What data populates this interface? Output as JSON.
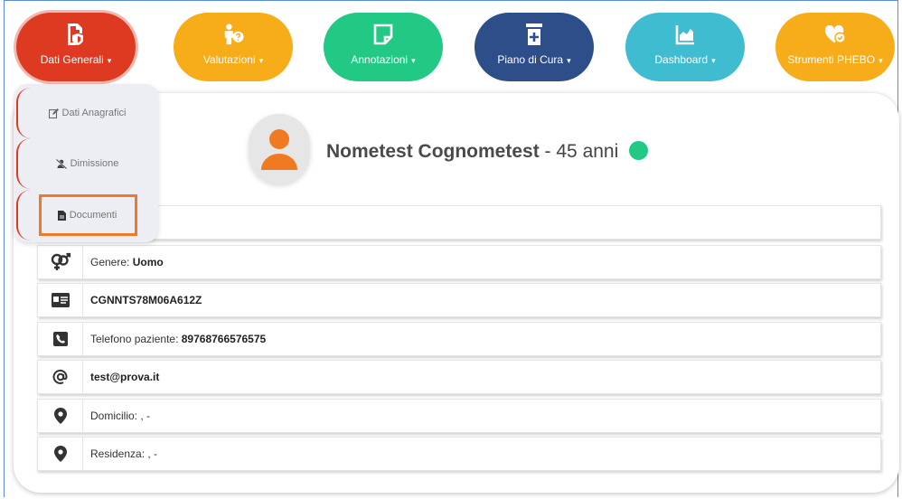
{
  "nav": {
    "dati_generali": "Dati Generali",
    "valutazioni": "Valutazioni",
    "annotazioni": "Annotazioni",
    "piano_di_cura": "Piano di Cura",
    "dashboard": "Dashboard",
    "strumenti_phebo": "Strumenti PHEBO",
    "caret": "▾"
  },
  "dropdown": {
    "dati_anagrafici": "Dati Anagrafici",
    "dimissione": "Dimissione",
    "documenti": "Documenti"
  },
  "patient": {
    "name": "Nometest Cognometest",
    "age": "- 45 anni"
  },
  "rows": {
    "genere_label": "Genere: ",
    "genere_value": "Uomo",
    "codice_fiscale": "CGNNTS78M06A612Z",
    "telefono_label": "Telefono paziente: ",
    "telefono_value": "89768766576575",
    "email": "test@prova.it",
    "domicilio": "Domicilio: , -",
    "residenza": "Residenza: , -"
  },
  "colors": {
    "red": "#dd3a21",
    "orange": "#f7ac19",
    "green": "#22c985",
    "navy": "#2e4e8a",
    "cyan": "#3fbcd0",
    "highlight": "#f0782a"
  }
}
